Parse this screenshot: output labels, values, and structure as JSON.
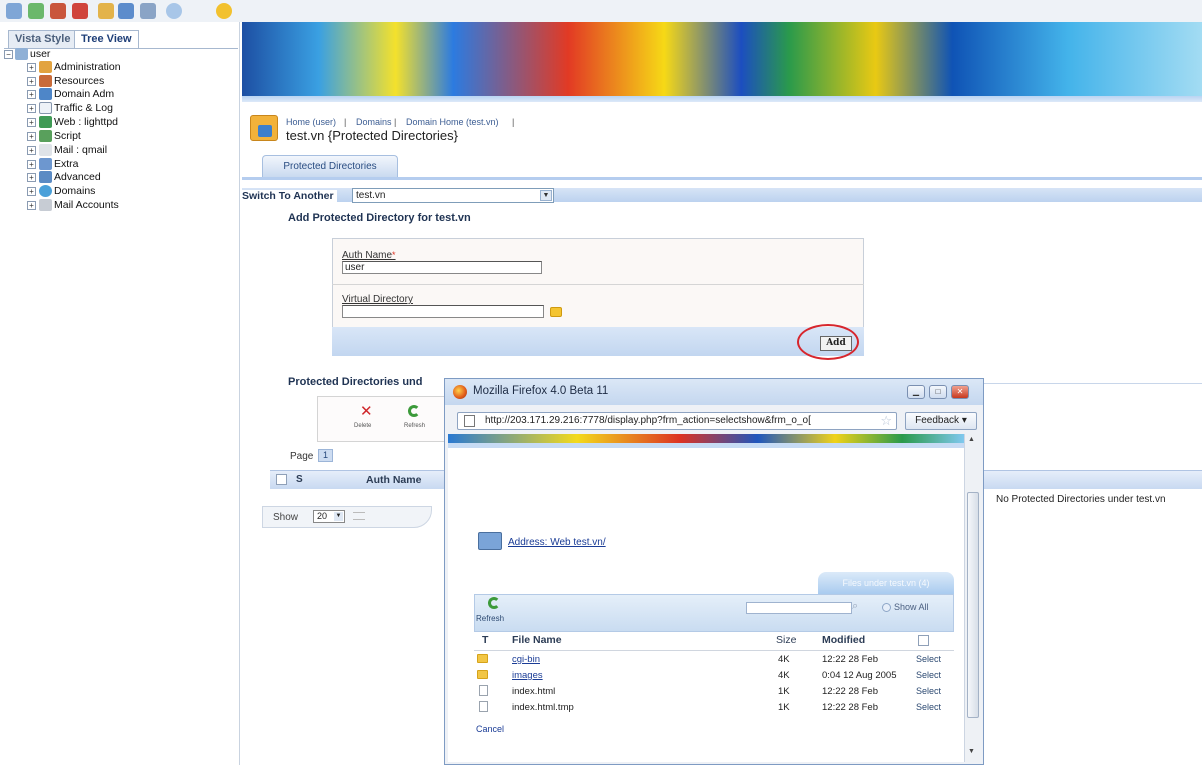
{
  "toolbar": {
    "icons": [
      "network-icon",
      "check-icon",
      "gear-icon",
      "user-icon",
      "pin-icon",
      "shield-icon",
      "globe-icon",
      "cloud-icon",
      "star-icon"
    ]
  },
  "left": {
    "tabs": [
      "Vista Style",
      "Tree View"
    ],
    "active_tab": "Tree View",
    "root": "user",
    "items": [
      "Administration",
      "Resources",
      "Domain Adm",
      "Traffic & Log",
      "Web : lighttpd",
      "Script",
      "Mail : qmail",
      "Extra",
      "Advanced",
      "Domains",
      "Mail Accounts"
    ]
  },
  "breadcrumb": {
    "items": [
      "Home (user)",
      "Domains",
      "Domain Home (test.vn)"
    ],
    "separator": "|"
  },
  "page": {
    "title": "test.vn {Protected Directories}",
    "tab": "Protected Directories"
  },
  "switch": {
    "label": "Switch To Another",
    "value": "test.vn"
  },
  "form": {
    "heading": "Add Protected Directory for test.vn",
    "auth_label": "Auth Name",
    "required_mark": "*",
    "auth_value": "user",
    "vdir_label": "Virtual Directory",
    "vdir_value": "",
    "add_label": "Add"
  },
  "list": {
    "heading": "Protected Directories und",
    "delete_label": "Delete",
    "refresh_label": "Refresh",
    "page_label": "Page",
    "page_num": "1",
    "col_s": "S",
    "col_auth": "Auth Name",
    "empty_text": "No Protected Directories under test.vn",
    "show_label": "Show",
    "show_value": "20"
  },
  "popup": {
    "title": "Mozilla Firefox 4.0 Beta 11",
    "url": "http://203.171.29.216:7778/display.php?frm_action=selectshow&frm_o_o[",
    "feedback": "Feedback",
    "address": "Address: Web test.vn/",
    "files_tab": "Files under test.vn (4)",
    "refresh": "Refresh",
    "show_all": "Show All",
    "headers": {
      "type": "T",
      "name": "File Name",
      "size": "Size",
      "modified": "Modified"
    },
    "files": [
      {
        "type": "folder",
        "name": "cgi-bin",
        "size": "4K",
        "modified": "12:22 28 Feb",
        "select": "Select"
      },
      {
        "type": "folder",
        "name": "images",
        "size": "4K",
        "modified": "0:04 12 Aug 2005",
        "select": "Select"
      },
      {
        "type": "file",
        "name": "index.html",
        "size": "1K",
        "modified": "12:22 28 Feb",
        "select": "Select"
      },
      {
        "type": "file",
        "name": "index.html.tmp",
        "size": "1K",
        "modified": "12:22 28 Feb",
        "select": "Select"
      }
    ],
    "cancel": "Cancel"
  },
  "colors": {
    "accent": "#3c5d93",
    "highlight_circle": "#d7262d"
  }
}
